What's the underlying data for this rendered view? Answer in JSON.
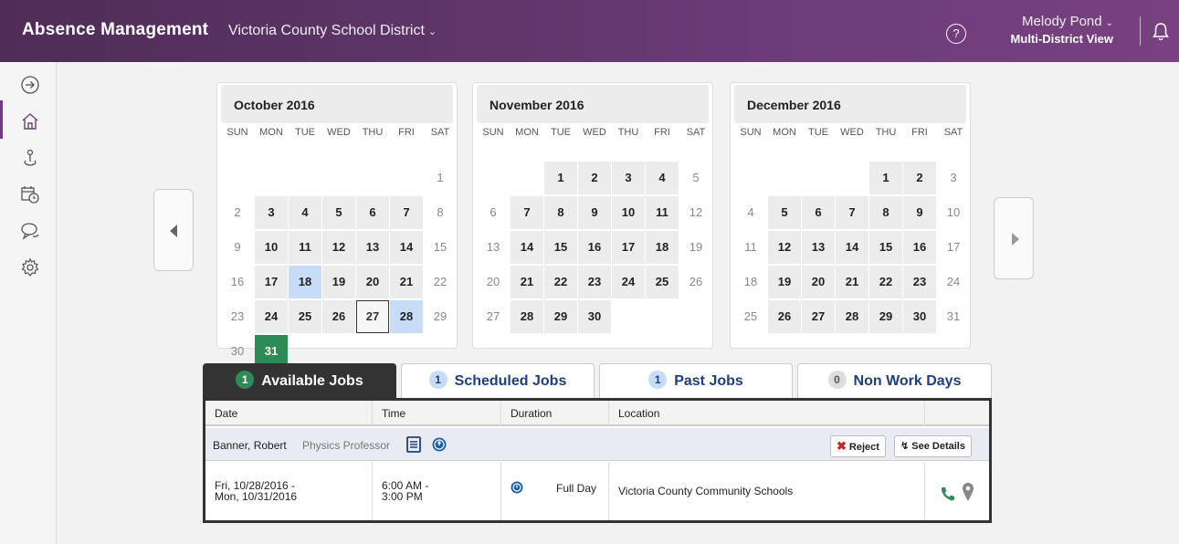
{
  "header": {
    "app_title": "Absence Management",
    "district": "Victoria County School District",
    "user_name": "Melody Pond",
    "user_view": "Multi-District View",
    "help_glyph": "?"
  },
  "sidebar": {
    "icons": [
      "arrow-right-circle-icon",
      "home-icon",
      "substitute-icon",
      "schedule-icon",
      "chat-icon",
      "gear-icon"
    ],
    "active": "home-icon"
  },
  "calendars": [
    {
      "title": "October 2016",
      "dow": [
        "SUN",
        "MON",
        "TUE",
        "WED",
        "THU",
        "FRI",
        "SAT"
      ],
      "offset": 6,
      "days": 31,
      "highlight": [
        3,
        4,
        5,
        6,
        7,
        10,
        11,
        12,
        13,
        14,
        17,
        19,
        20,
        21,
        24,
        25,
        26
      ],
      "selected": [
        18,
        28
      ],
      "today": 27,
      "green": [
        31
      ]
    },
    {
      "title": "November 2016",
      "dow": [
        "SUN",
        "MON",
        "TUE",
        "WED",
        "THU",
        "FRI",
        "SAT"
      ],
      "offset": 2,
      "days": 30,
      "highlight": [
        1,
        2,
        3,
        4,
        7,
        8,
        9,
        10,
        11,
        14,
        15,
        16,
        17,
        18,
        21,
        22,
        23,
        24,
        25,
        28,
        29,
        30
      ],
      "selected": [],
      "today": null,
      "green": []
    },
    {
      "title": "December 2016",
      "dow": [
        "SUN",
        "MON",
        "TUE",
        "WED",
        "THU",
        "FRI",
        "SAT"
      ],
      "offset": 4,
      "days": 31,
      "highlight": [
        1,
        2,
        5,
        6,
        7,
        8,
        9,
        12,
        13,
        14,
        15,
        16,
        19,
        20,
        21,
        22,
        23,
        26,
        27,
        28,
        29,
        30
      ],
      "selected": [],
      "today": null,
      "green": []
    }
  ],
  "tabs": [
    {
      "label": "Available Jobs",
      "count": "1",
      "badge": "green",
      "active": true
    },
    {
      "label": "Scheduled Jobs",
      "count": "1",
      "badge": "blue",
      "active": false
    },
    {
      "label": "Past Jobs",
      "count": "1",
      "badge": "blue",
      "active": false
    },
    {
      "label": "Non Work Days",
      "count": "0",
      "badge": "grey",
      "active": false
    }
  ],
  "table": {
    "columns": [
      "Date",
      "Time",
      "Duration",
      "Location"
    ],
    "job": {
      "employee": "Banner, Robert",
      "role": "Physics Professor",
      "reject_label": "Reject",
      "details_label": "See Details",
      "date_line1": "Fri, 10/28/2016 -",
      "date_line2": "Mon, 10/31/2016",
      "time_line1": "6:00 AM -",
      "time_line2": "3:00 PM",
      "duration": "Full Day",
      "location": "Victoria County Community Schools"
    }
  },
  "colors": {
    "header_purple": "#5d3468",
    "green": "#2e8b57",
    "selected_blue": "#c7dcf7",
    "tab_blue": "#1d3f80",
    "reject_red": "#c62828"
  }
}
